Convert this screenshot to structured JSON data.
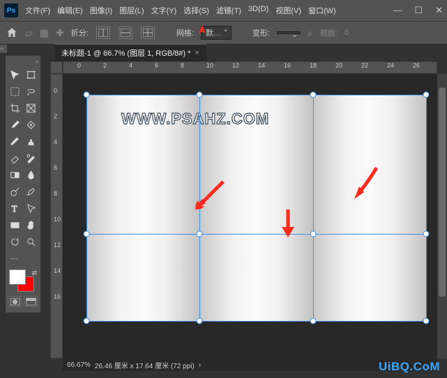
{
  "menubar": {
    "items": [
      "文件(F)",
      "编辑(E)",
      "图像(I)",
      "图层(L)",
      "文字(Y)",
      "选择(S)",
      "滤镜(T)",
      "3D(D)",
      "视图(V)",
      "窗口(W)"
    ]
  },
  "optionsbar": {
    "fold_label": "折分:",
    "grid_label": "网格:",
    "grid_value": "默…",
    "transform_label": "变形:",
    "transform_value": "",
    "curve_label": "翘曲:",
    "curve_value": "0"
  },
  "tab": {
    "title": "未标题-1 @ 66.7% (图层 1, RGB/8#) *"
  },
  "ruler": {
    "h": [
      "0",
      "2",
      "4",
      "6",
      "8",
      "10",
      "12",
      "14",
      "16",
      "18",
      "20",
      "22",
      "24",
      "26"
    ],
    "v": [
      "0",
      "2",
      "4",
      "6",
      "8",
      "10",
      "12",
      "14",
      "16"
    ]
  },
  "canvas": {
    "watermark": "WWW.PSAHZ.COM"
  },
  "status": {
    "zoom": "66.67%",
    "info": "26.46 厘米 x 17.64 厘米 (72 ppi)"
  },
  "watermark_site": "UiBQ.CoM",
  "colors": {
    "fg": "#ffffff",
    "bg": "#ff0000",
    "accent": "#3b8eea"
  },
  "tool_names": [
    "move",
    "artboard",
    "marquee",
    "lasso",
    "crop",
    "frame",
    "eyedropper",
    "patch",
    "brush",
    "clone",
    "eraser",
    "history-brush",
    "gradient",
    "blur",
    "dodge",
    "pen",
    "type",
    "path-select",
    "rectangle",
    "hand",
    "rotate-view",
    "zoom",
    "edit-toolbar"
  ]
}
